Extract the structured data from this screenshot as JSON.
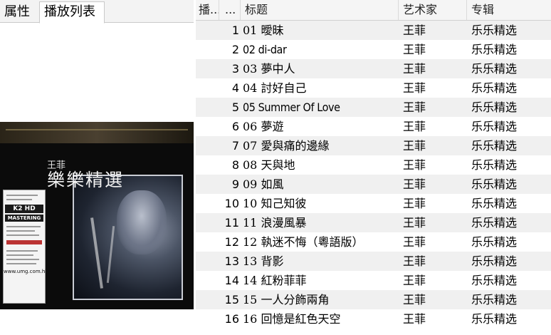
{
  "tabs": [
    "属性",
    "播放列表"
  ],
  "cover": {
    "artist": "王菲",
    "title": "樂樂精選",
    "sticker_k2": "K2 HD",
    "sticker_mastering": "MASTERING",
    "url": "www.umg.com.hk"
  },
  "table": {
    "columns": [
      "播...",
      "...",
      "标题",
      "艺术家",
      "专辑"
    ],
    "rows": [
      {
        "no": "1",
        "title": "01 曖昧",
        "artist": "王菲",
        "album": "乐乐精选"
      },
      {
        "no": "2",
        "title": "02 di-dar",
        "artist": "王菲",
        "album": "乐乐精选"
      },
      {
        "no": "3",
        "title": "03 夢中人",
        "artist": "王菲",
        "album": "乐乐精选"
      },
      {
        "no": "4",
        "title": "04 討好自己",
        "artist": "王菲",
        "album": "乐乐精选"
      },
      {
        "no": "5",
        "title": "05 Summer Of Love",
        "artist": "王菲",
        "album": "乐乐精选"
      },
      {
        "no": "6",
        "title": "06 夢遊",
        "artist": "王菲",
        "album": "乐乐精选"
      },
      {
        "no": "7",
        "title": "07 愛與痛的邊緣",
        "artist": "王菲",
        "album": "乐乐精选"
      },
      {
        "no": "8",
        "title": "08 天與地",
        "artist": "王菲",
        "album": "乐乐精选"
      },
      {
        "no": "9",
        "title": "09 如風",
        "artist": "王菲",
        "album": "乐乐精选"
      },
      {
        "no": "10",
        "title": "10 知己知彼",
        "artist": "王菲",
        "album": "乐乐精选"
      },
      {
        "no": "11",
        "title": "11 浪漫風暴",
        "artist": "王菲",
        "album": "乐乐精选"
      },
      {
        "no": "12",
        "title": "12 執迷不悔（粵語版）",
        "artist": "王菲",
        "album": "乐乐精选"
      },
      {
        "no": "13",
        "title": "13 背影",
        "artist": "王菲",
        "album": "乐乐精选"
      },
      {
        "no": "14",
        "title": "14 紅粉菲菲",
        "artist": "王菲",
        "album": "乐乐精选"
      },
      {
        "no": "15",
        "title": "15 一人分飾兩角",
        "artist": "王菲",
        "album": "乐乐精选"
      },
      {
        "no": "16",
        "title": "16 回憶是紅色天空",
        "artist": "王菲",
        "album": "乐乐精选"
      }
    ]
  }
}
